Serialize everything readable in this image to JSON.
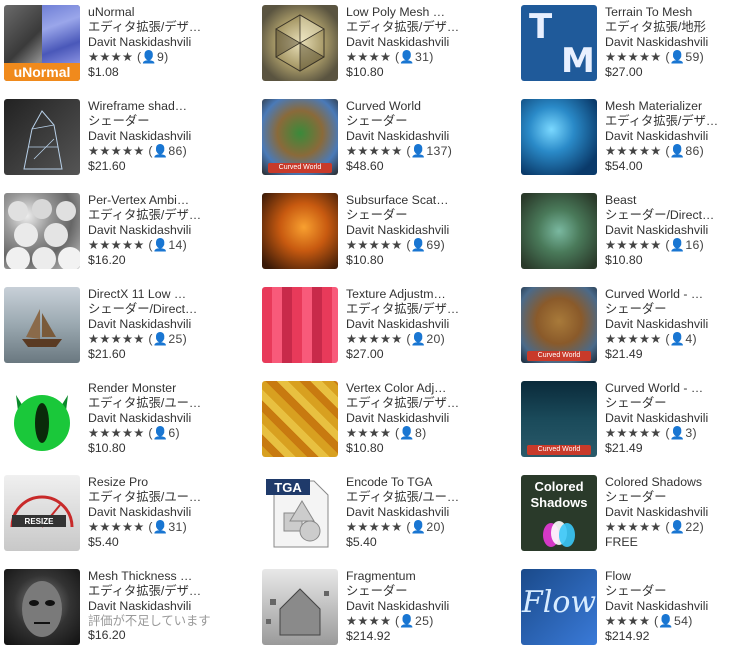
{
  "items": [
    {
      "title": "uNormal",
      "category": "エディタ拡張/デザ…",
      "publisher": "Davit Naskidashvili",
      "stars": "★★★★",
      "count": "(👤9)",
      "price": "$1.08",
      "thumb_label": "uNormal"
    },
    {
      "title": "Low Poly Mesh …",
      "category": "エディタ拡張/デザ…",
      "publisher": "Davit Naskidashvili",
      "stars": "★★★★",
      "count": "(👤31)",
      "price": "$10.80"
    },
    {
      "title": "Terrain To Mesh",
      "category": "エディタ拡張/地形",
      "publisher": "Davit Naskidashvili",
      "stars": "★★★★★",
      "count": "(👤59)",
      "price": "$27.00",
      "thumb_letters": [
        "T",
        "M"
      ]
    },
    {
      "title": "Wireframe shad…",
      "category": "シェーダー",
      "publisher": "Davit Naskidashvili",
      "stars": "★★★★★",
      "count": "(👤86)",
      "price": "$21.60"
    },
    {
      "title": "Curved World",
      "category": "シェーダー",
      "publisher": "Davit Naskidashvili",
      "stars": "★★★★★",
      "count": "(👤137)",
      "price": "$48.60",
      "thumb_label": "Curved World"
    },
    {
      "title": "Mesh Materializer",
      "category": "エディタ拡張/デザ…",
      "publisher": "Davit Naskidashvili",
      "stars": "★★★★★",
      "count": "(👤86)",
      "price": "$54.00"
    },
    {
      "title": "Per-Vertex Ambi…",
      "category": "エディタ拡張/デザ…",
      "publisher": "Davit Naskidashvili",
      "stars": "★★★★★",
      "count": "(👤14)",
      "price": "$16.20"
    },
    {
      "title": "Subsurface Scat…",
      "category": "シェーダー",
      "publisher": "Davit Naskidashvili",
      "stars": "★★★★★",
      "count": "(👤69)",
      "price": "$10.80"
    },
    {
      "title": "Beast",
      "category": "シェーダー/Direct…",
      "publisher": "Davit Naskidashvili",
      "stars": "★★★★★",
      "count": "(👤16)",
      "price": "$10.80"
    },
    {
      "title": "DirectX 11 Low …",
      "category": "シェーダー/Direct…",
      "publisher": "Davit Naskidashvili",
      "stars": "★★★★★",
      "count": "(👤25)",
      "price": "$21.60"
    },
    {
      "title": "Texture Adjustm…",
      "category": "エディタ拡張/デザ…",
      "publisher": "Davit Naskidashvili",
      "stars": "★★★★★",
      "count": "(👤20)",
      "price": "$27.00"
    },
    {
      "title": "Curved World - …",
      "category": "シェーダー",
      "publisher": "Davit Naskidashvili",
      "stars": "★★★★★",
      "count": "(👤4)",
      "price": "$21.49",
      "thumb_label": "Curved World"
    },
    {
      "title": "Render Monster",
      "category": "エディタ拡張/ユー…",
      "publisher": "Davit Naskidashvili",
      "stars": "★★★★★",
      "count": "(👤6)",
      "price": "$10.80"
    },
    {
      "title": "Vertex Color Adj…",
      "category": "エディタ拡張/デザ…",
      "publisher": "Davit Naskidashvili",
      "stars": "★★★★",
      "count": "(👤8)",
      "price": "$10.80"
    },
    {
      "title": "Curved World - …",
      "category": "シェーダー",
      "publisher": "Davit Naskidashvili",
      "stars": "★★★★★",
      "count": "(👤3)",
      "price": "$21.49",
      "thumb_label": "Curved World"
    },
    {
      "title": "Resize Pro",
      "category": "エディタ拡張/ユー…",
      "publisher": "Davit Naskidashvili",
      "stars": "★★★★★",
      "count": "(👤31)",
      "price": "$5.40",
      "thumb_label": "RESIZE"
    },
    {
      "title": "Encode To TGA",
      "category": "エディタ拡張/ユー…",
      "publisher": "Davit Naskidashvili",
      "stars": "★★★★★",
      "count": "(👤20)",
      "price": "$5.40",
      "thumb_label": "TGA"
    },
    {
      "title": "Colored Shadows",
      "category": "シェーダー",
      "publisher": "Davit Naskidashvili",
      "stars": "★★★★★",
      "count": "(👤22)",
      "price": "FREE",
      "thumb_label": "Colored Shadows"
    },
    {
      "title": "Mesh Thickness …",
      "category": "エディタ拡張/デザ…",
      "publisher": "Davit Naskidashvili",
      "stars": "",
      "count": "",
      "no_rating": "評価が不足しています",
      "price": "$16.20"
    },
    {
      "title": "Fragmentum",
      "category": "シェーダー",
      "publisher": "Davit Naskidashvili",
      "stars": "★★★★",
      "count": "(👤25)",
      "price": "$214.92"
    },
    {
      "title": "Flow",
      "category": "シェーダー",
      "publisher": "Davit Naskidashvili",
      "stars": "★★★★",
      "count": "(👤54)",
      "price": "$214.92",
      "thumb_label": "Flow"
    }
  ]
}
